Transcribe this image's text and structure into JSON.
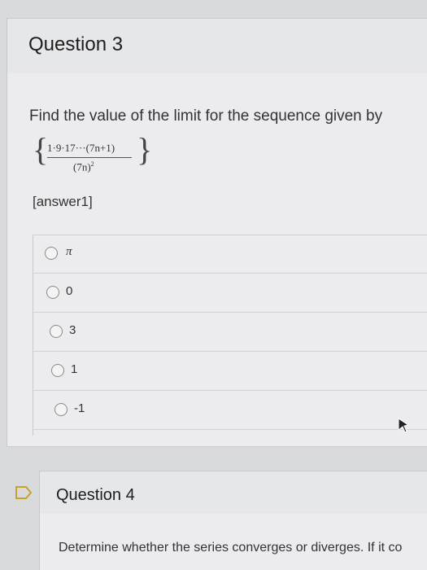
{
  "question3": {
    "title": "Question 3",
    "prompt": "Find the value of the limit for the sequence given by",
    "sequence": {
      "numerator": "1·9·17···(7n+1)",
      "denominator": "(7n)",
      "exponent": "2"
    },
    "answer_placeholder": "[answer1]",
    "choices": [
      {
        "label": "π"
      },
      {
        "label": "0"
      },
      {
        "label": "3"
      },
      {
        "label": "1"
      },
      {
        "label": "-1"
      }
    ]
  },
  "question4": {
    "title": "Question 4",
    "prompt": "Determine whether the series converges or diverges. If it co"
  },
  "icons": {
    "radio": "radio-button-icon",
    "flag": "flag-icon",
    "cursor": "mouse-pointer-icon"
  }
}
